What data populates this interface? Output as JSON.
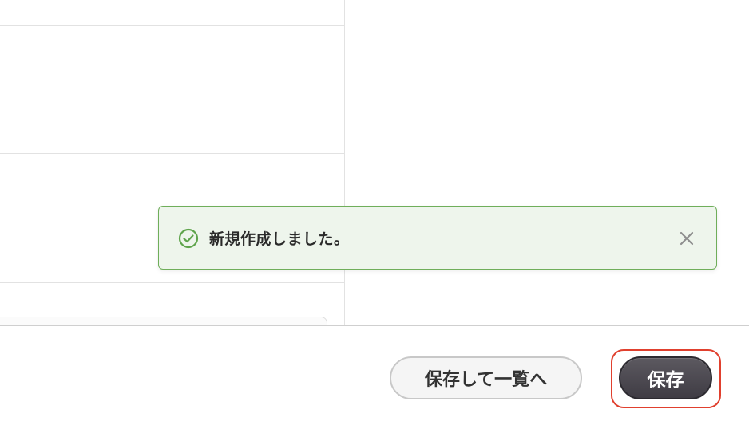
{
  "toast": {
    "message": "新規作成しました。",
    "status_icon": "check-circle-icon",
    "close_icon": "close-icon",
    "accent_color": "#6fae5a",
    "background_color": "#eef5ec"
  },
  "footer": {
    "save_and_list_label": "保存して一覧へ",
    "save_label": "保存",
    "save_focus_color": "#e0402e"
  }
}
